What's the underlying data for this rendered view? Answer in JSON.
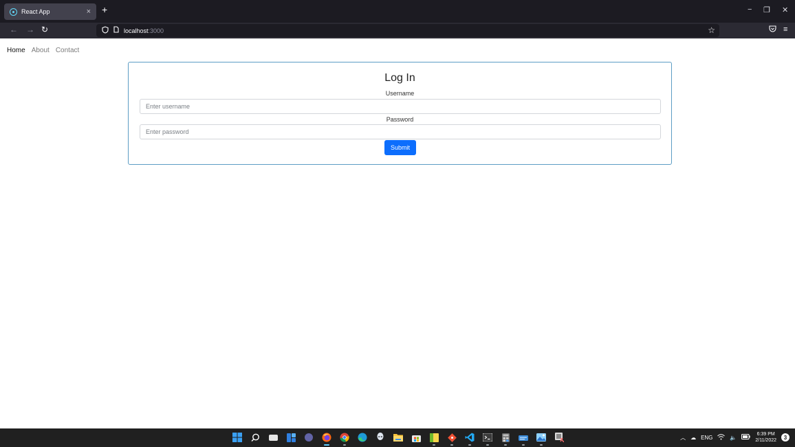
{
  "browser": {
    "tab_title": "React App",
    "tab_close": "×",
    "new_tab": "+",
    "window_controls": {
      "minimize": "−",
      "restore": "❐",
      "close": "✕"
    },
    "nav": {
      "back": "←",
      "forward": "→",
      "reload": "↻"
    },
    "url": {
      "host": "localhost",
      "port": ":3000"
    },
    "icons": [
      "shield-icon",
      "page-icon",
      "bookmark-star-icon",
      "pocket-icon",
      "menu-icon"
    ]
  },
  "page": {
    "nav": [
      {
        "label": "Home",
        "active": true
      },
      {
        "label": "About",
        "active": false
      },
      {
        "label": "Contact",
        "active": false
      }
    ],
    "form": {
      "title": "Log In",
      "username_label": "Username",
      "username_placeholder": "Enter username",
      "password_label": "Password",
      "password_placeholder": "Enter password",
      "submit_label": "Submit"
    },
    "colors": {
      "card_border": "#5b9cc4",
      "submit_bg": "#0d6efd"
    }
  },
  "taskbar": {
    "apps": [
      "windows-start-icon",
      "search-icon",
      "task-view-icon",
      "widgets-icon",
      "chat-icon",
      "firefox-icon",
      "chrome-icon",
      "edge-icon",
      "alienware-icon",
      "file-explorer-icon",
      "store-icon",
      "sticky-notes-icon",
      "git-icon",
      "vscode-icon",
      "terminal-icon",
      "calculator-icon",
      "notepad-icon",
      "photos-icon",
      "snipping-tool-icon"
    ],
    "tray": {
      "language": "ENG",
      "time": "6:39 PM",
      "date": "2/11/2022",
      "notifications": "3"
    }
  }
}
